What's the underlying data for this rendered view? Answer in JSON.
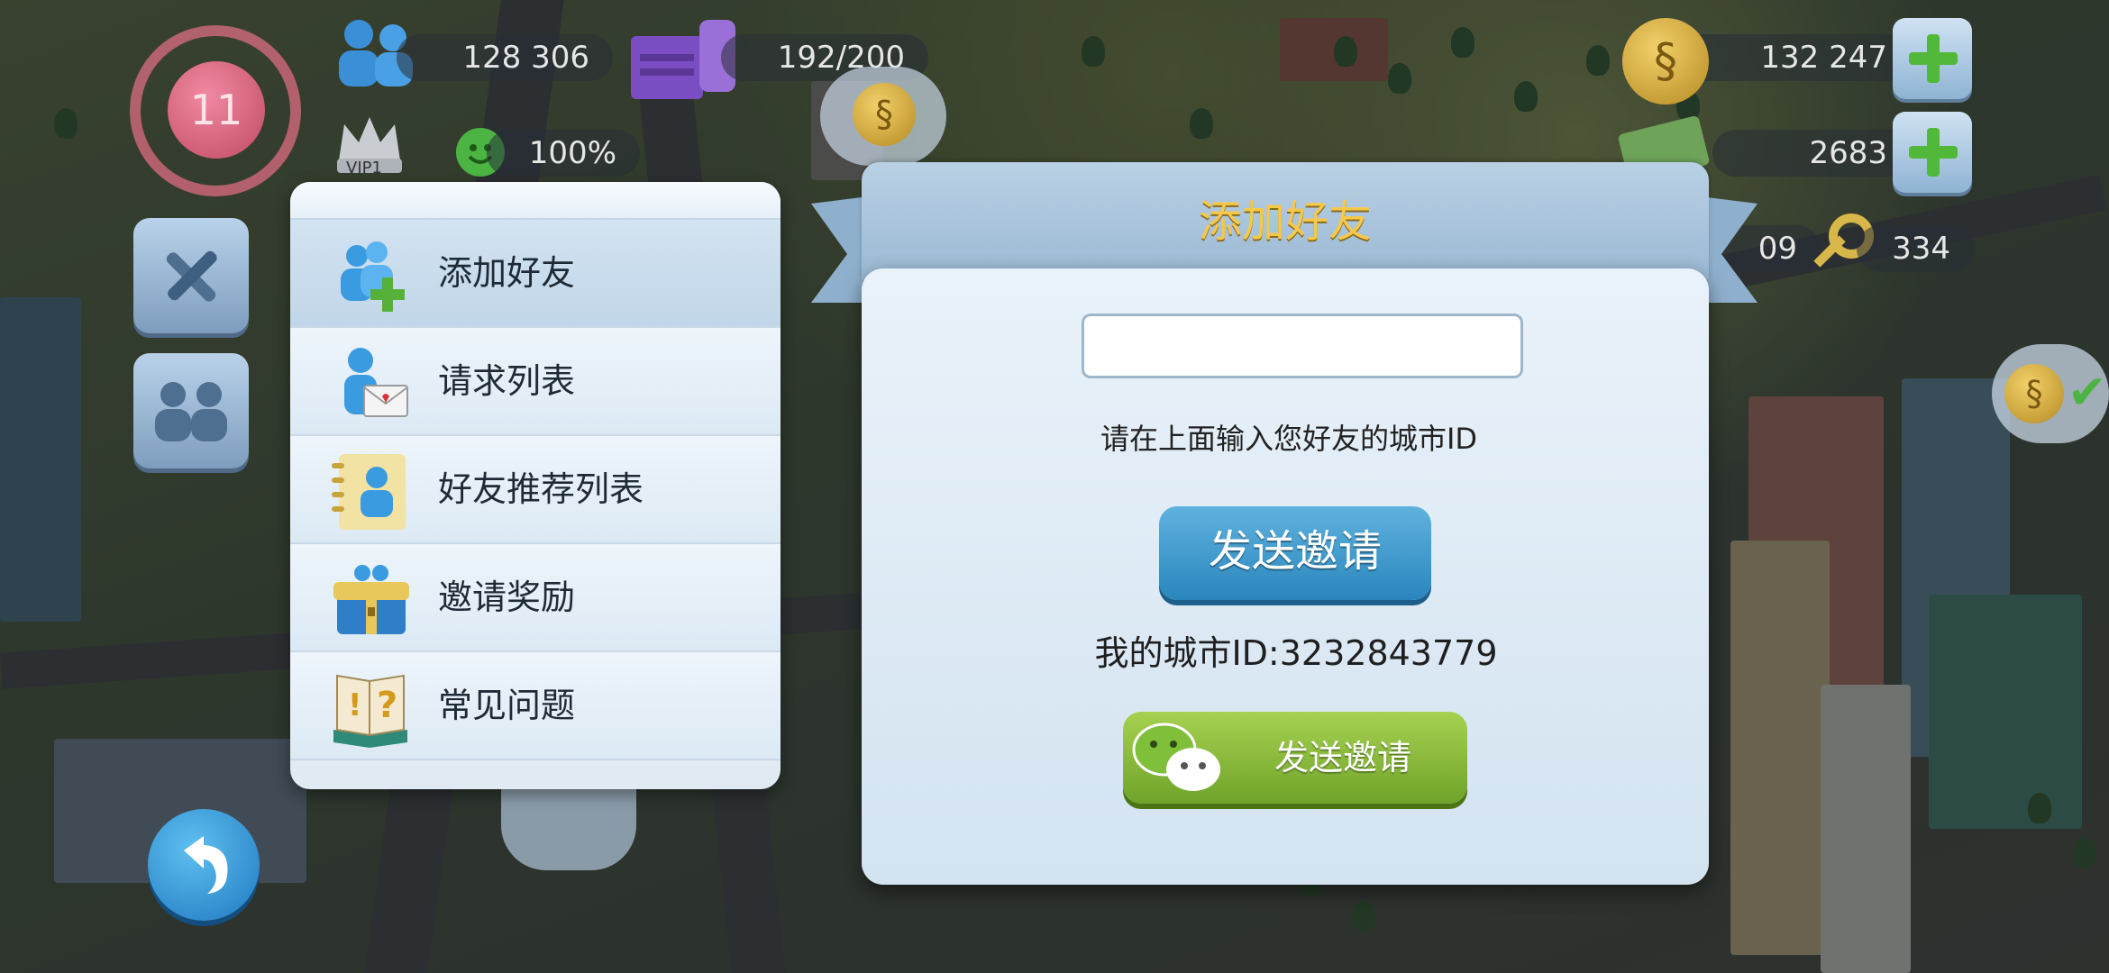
{
  "hud": {
    "level": "11",
    "population": "128 306",
    "storage": "192/200",
    "vip_label": "VIP1",
    "happiness": "100%",
    "simoleons": "132 247",
    "simcash": "2683",
    "keys": "334",
    "partial_value": "09"
  },
  "menu": {
    "items": [
      {
        "label": "添加好友",
        "icon": "add-friend-icon"
      },
      {
        "label": "请求列表",
        "icon": "request-mail-icon"
      },
      {
        "label": "好友推荐列表",
        "icon": "friend-recommend-icon"
      },
      {
        "label": "邀请奖励",
        "icon": "gift-chest-icon"
      },
      {
        "label": "常见问题",
        "icon": "faq-book-icon"
      }
    ]
  },
  "dialog": {
    "title": "添加好友",
    "input_value": "",
    "hint": "请在上面输入您好友的城市ID",
    "send_label": "发送邀请",
    "my_city_id": "我的城市ID:3232843779",
    "wechat_label": "发送邀请"
  },
  "colors": {
    "title": "#f6c84a",
    "send_button": "#2a86bd",
    "wechat_button": "#6fa32a"
  }
}
